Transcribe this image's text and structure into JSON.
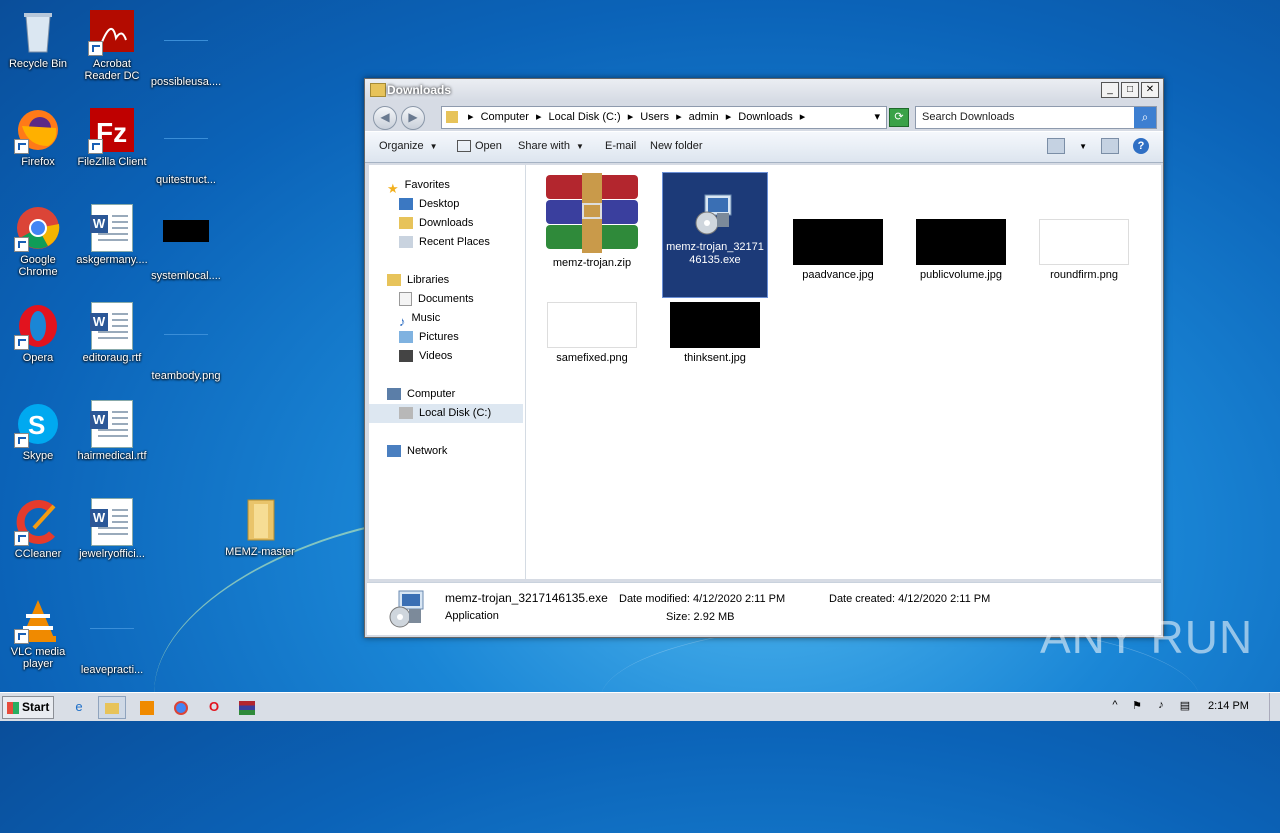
{
  "desktop": {
    "icons": [
      {
        "label": "Recycle Bin"
      },
      {
        "label": "Acrobat Reader DC"
      },
      {
        "label": "possibleusa...."
      },
      {
        "label": "Firefox"
      },
      {
        "label": "FileZilla Client"
      },
      {
        "label": "quitestruct..."
      },
      {
        "label": "Google Chrome"
      },
      {
        "label": "askgermany...."
      },
      {
        "label": "systemlocal...."
      },
      {
        "label": "Opera"
      },
      {
        "label": "editoraug.rtf"
      },
      {
        "label": "teambody.png"
      },
      {
        "label": "Skype"
      },
      {
        "label": "hairmedical.rtf"
      },
      {
        "label": "CCleaner"
      },
      {
        "label": "jewelryoffici..."
      },
      {
        "label": "MEMZ-master"
      },
      {
        "label": "VLC media player"
      },
      {
        "label": "leavepracti..."
      }
    ]
  },
  "window": {
    "title": "Downloads",
    "controls": {
      "minimize": "_",
      "maximize": "□",
      "close": "✕"
    },
    "breadcrumb": [
      "Computer",
      "Local Disk (C:)",
      "Users",
      "admin",
      "Downloads"
    ],
    "search_placeholder": "Search Downloads",
    "toolbar": {
      "organize": "Organize",
      "open": "Open",
      "share_with": "Share with",
      "email": "E-mail",
      "new_folder": "New folder"
    },
    "nav": {
      "favorites": "Favorites",
      "desktop": "Desktop",
      "downloads": "Downloads",
      "recent_places": "Recent Places",
      "libraries": "Libraries",
      "documents": "Documents",
      "music": "Music",
      "pictures": "Pictures",
      "videos": "Videos",
      "computer": "Computer",
      "local_disk": "Local Disk (C:)",
      "network": "Network"
    },
    "files": [
      {
        "name": "memz-trojan.zip"
      },
      {
        "name": "memz-trojan_3217146135.exe"
      },
      {
        "name": "paadvance.jpg"
      },
      {
        "name": "publicvolume.jpg"
      },
      {
        "name": "roundfirm.png"
      },
      {
        "name": "samefixed.png"
      },
      {
        "name": "thinksent.jpg"
      }
    ],
    "details": {
      "filename": "memz-trojan_3217146135.exe",
      "type": "Application",
      "date_modified_label": "Date modified:",
      "date_modified": "4/12/2020 2:11 PM",
      "date_created_label": "Date created:",
      "date_created": "4/12/2020 2:11 PM",
      "size_label": "Size:",
      "size": "2.92 MB"
    }
  },
  "taskbar": {
    "start_label": "Start",
    "clock": "2:14 PM"
  },
  "watermark": "ANY RUN",
  "colors": {
    "selection": "#1c3a78",
    "desktop_bg": "#1a86d6",
    "search_button": "#3d7fd1"
  }
}
